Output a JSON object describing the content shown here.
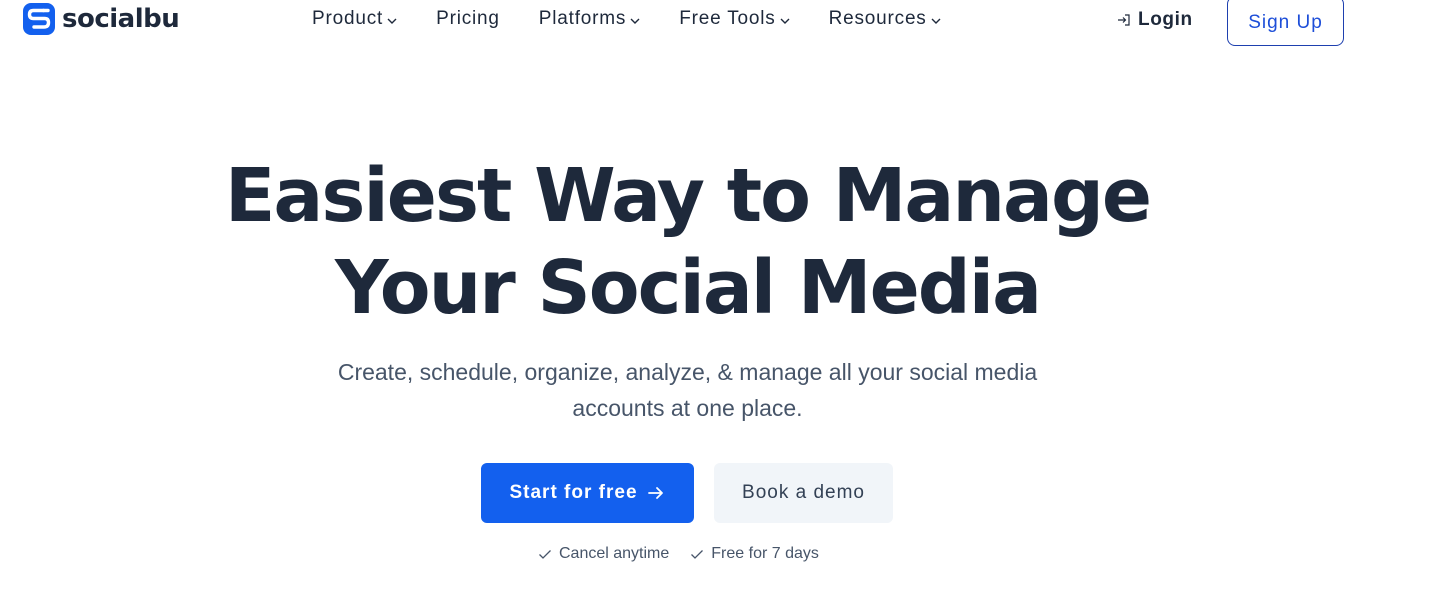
{
  "brand": {
    "name": "socialbu",
    "color": "#1360ee"
  },
  "nav": {
    "items": [
      {
        "label": "Product",
        "has_dropdown": true
      },
      {
        "label": "Pricing",
        "has_dropdown": false
      },
      {
        "label": "Platforms",
        "has_dropdown": true
      },
      {
        "label": "Free Tools",
        "has_dropdown": true
      },
      {
        "label": "Resources",
        "has_dropdown": true
      }
    ],
    "login_label": "Login",
    "signup_label": "Sign Up"
  },
  "hero": {
    "title_line1": "Easiest Way to Manage",
    "title_line2": "Your Social Media",
    "subtitle_line1": "Create, schedule, organize, analyze, & manage all your social media",
    "subtitle_line2": "accounts at one place.",
    "primary_cta": "Start for free",
    "secondary_cta": "Book a demo",
    "perks": [
      "Cancel anytime",
      "Free for 7 days"
    ]
  },
  "colors": {
    "primary": "#1360ee",
    "heading": "#1e293b",
    "muted": "#475569",
    "secondary_bg": "#f1f5f9",
    "signup_border": "#1e40af"
  },
  "icons": {
    "logo": "socialbu-s-logo-icon",
    "dropdown": "chevron-down-icon",
    "login": "login-arrow-icon",
    "cta_arrow": "arrow-right-icon",
    "perk": "check-icon"
  }
}
